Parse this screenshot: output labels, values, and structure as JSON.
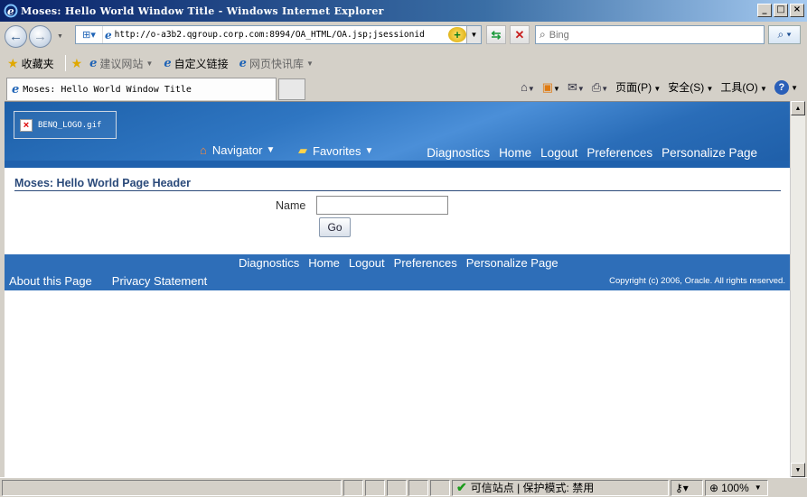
{
  "window": {
    "title": "Moses: Hello World Window Title - Windows Internet Explorer",
    "controls": [
      "_",
      "□",
      "×"
    ]
  },
  "address": {
    "url": "http://o-a3b2.qgroup.corp.com:8994/OA_HTML/OA.jsp;jsessionid"
  },
  "search": {
    "placeholder": "Bing"
  },
  "favorites_bar": {
    "favorites_label": "收藏夹",
    "items": [
      {
        "label": "建议网站",
        "dimmed": true
      },
      {
        "label": "自定义链接",
        "dimmed": false
      },
      {
        "label": "网页快讯库",
        "dimmed": true
      }
    ]
  },
  "tab": {
    "label": "Moses: Hello World Window Title"
  },
  "command_bar": {
    "page_label": "页面(P)",
    "safety_label": "安全(S)",
    "tools_label": "工具(O)",
    "help_glyph": "?"
  },
  "oa": {
    "logo_alt": "BENQ_LOGO.gif",
    "menus": [
      {
        "label": "Navigator"
      },
      {
        "label": "Favorites"
      }
    ],
    "global_links": [
      "Diagnostics",
      "Home",
      "Logout",
      "Preferences",
      "Personalize Page"
    ],
    "page_header": "Moses: Hello World Page Header",
    "form": {
      "name_label": "Name",
      "name_value": "",
      "go_label": "Go"
    },
    "footer": {
      "links": [
        "Diagnostics",
        "Home",
        "Logout",
        "Preferences",
        "Personalize Page"
      ],
      "about": "About this Page",
      "privacy": "Privacy Statement",
      "copyright": "Copyright (c) 2006, Oracle. All rights reserved."
    }
  },
  "status_bar": {
    "zone": "可信站点 | 保护模式: 禁用",
    "zoom": "100%"
  }
}
